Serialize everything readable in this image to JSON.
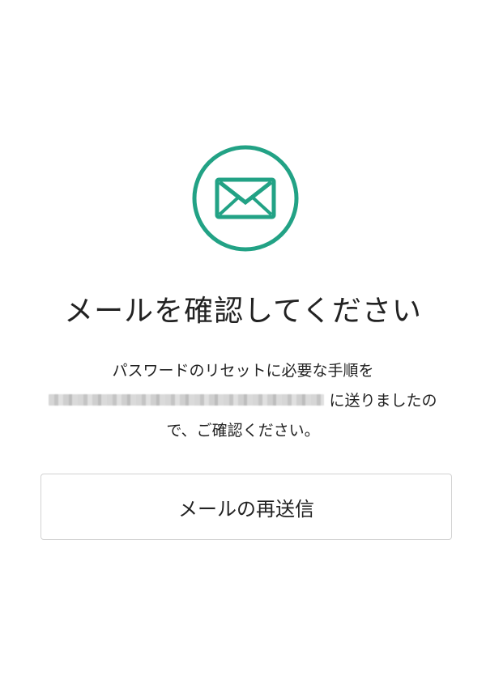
{
  "icon": {
    "name": "envelope-icon",
    "color": "#22a285"
  },
  "title": "メールを確認してください",
  "message": {
    "line1": "パスワードのリセットに必要な手順を",
    "line2_suffix": "に送りましたの",
    "line3": "で、ご確認ください。"
  },
  "resend_button": {
    "label": "メールの再送信"
  }
}
